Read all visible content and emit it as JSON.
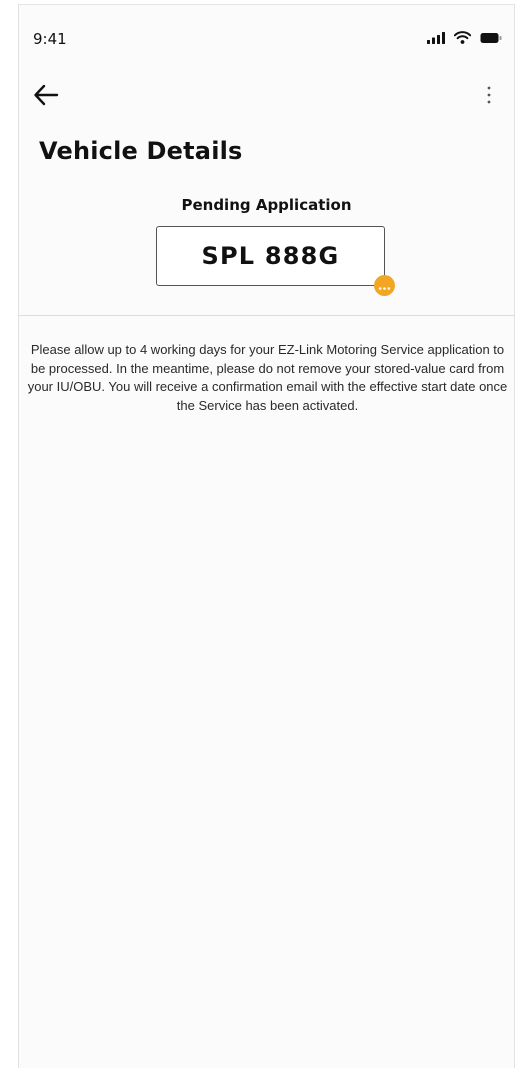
{
  "status_bar": {
    "time": "9:41",
    "icons": [
      "cellular-signal-icon",
      "wifi-icon",
      "battery-icon"
    ]
  },
  "app_bar": {
    "back_icon": "arrow-left-icon",
    "more_icon": "vertical-ellipsis-icon"
  },
  "page": {
    "title": "Vehicle Details",
    "application_status": "Pending Application",
    "plate_number": "SPL 888G",
    "pending_badge_icon": "ellipsis-icon",
    "info_message": "Please allow up to 4 working days for your EZ-Link Motoring Service application to be processed. In the meantime, please do not remove your stored-value card from your IU/OBU. You will receive a confirmation email with the effective start date once the Service has been activated."
  },
  "colors": {
    "background": "#fbfbfb",
    "text": "#111111",
    "badge": "#f2a724",
    "plate_border": "#555555",
    "divider": "#dddddd"
  }
}
